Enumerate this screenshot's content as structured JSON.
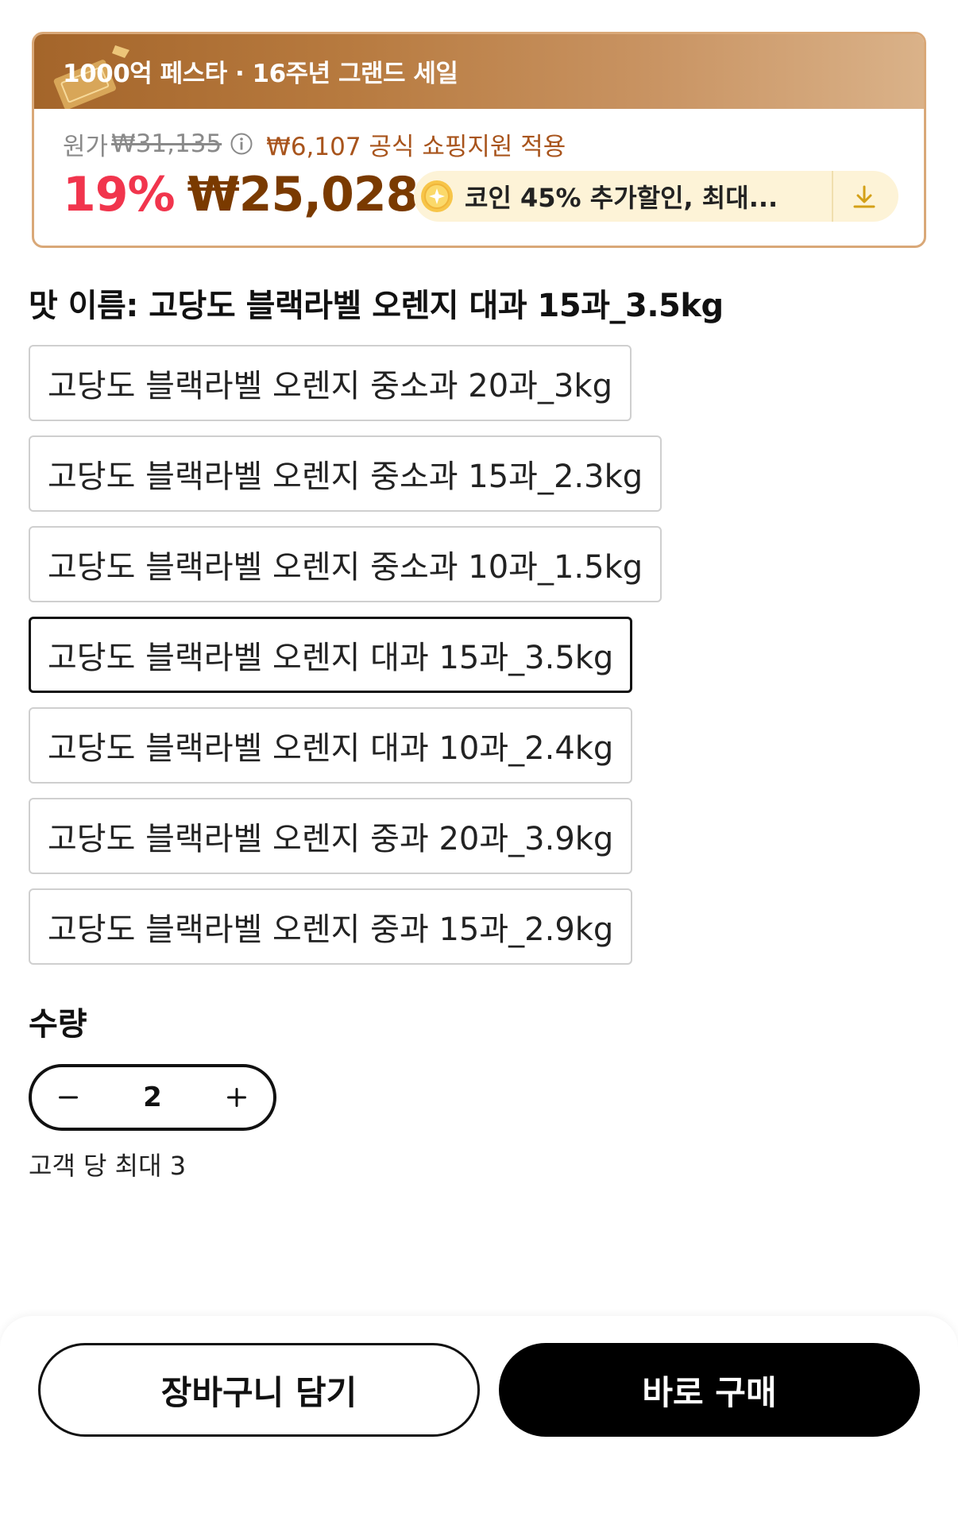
{
  "promo": {
    "title": "1000억 페스타 · 16주년 그랜드 세일",
    "original_label": "원가",
    "original_price": "₩31,135",
    "subsidy_text": "₩6,107 공식 쇼핑지원 적용",
    "discount_percent": "19%",
    "sale_price": "₩25,028",
    "coin_text": "코인 45% 추가할인, 최대...",
    "colors": {
      "header_gradient_start": "#a4652a",
      "header_gradient_end": "#dab289",
      "discount": "#f1354d",
      "sale_price": "#7a3a00",
      "subsidy": "#a8541c",
      "coin_pill": "#fdf3d7"
    },
    "icons": [
      "ticket-icon",
      "info-icon",
      "coin-icon",
      "download-icon"
    ]
  },
  "options": {
    "title": "맛 이름: 고당도 블랙라벨 오렌지 대과 15과_3.5kg",
    "selected_index": 3,
    "items": [
      {
        "label": "고당도 블랙라벨 오렌지 중소과 20과_3kg"
      },
      {
        "label": "고당도 블랙라벨 오렌지 중소과 15과_2.3kg"
      },
      {
        "label": "고당도 블랙라벨 오렌지 중소과 10과_1.5kg"
      },
      {
        "label": "고당도 블랙라벨 오렌지 대과 15과_3.5kg"
      },
      {
        "label": "고당도 블랙라벨 오렌지 대과 10과_2.4kg"
      },
      {
        "label": "고당도 블랙라벨 오렌지 중과 20과_3.9kg"
      },
      {
        "label": "고당도 블랙라벨 오렌지 중과 15과_2.9kg"
      }
    ]
  },
  "quantity": {
    "label": "수량",
    "value": "2",
    "limit_text": "고객 당 최대 3",
    "icons": [
      "minus-icon",
      "plus-icon"
    ]
  },
  "actions": {
    "cart_label": "장바구니 담기",
    "buy_label": "바로 구매"
  }
}
